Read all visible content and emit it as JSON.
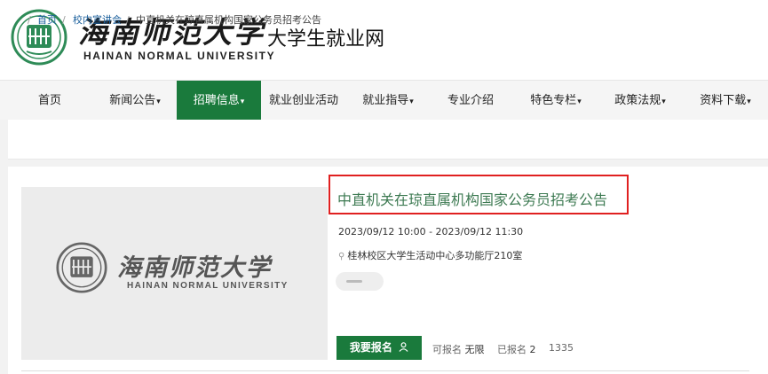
{
  "header": {
    "logo_cn": "海南师范大学",
    "logo_en": "HAINAN NORMAL UNIVERSITY",
    "site_name": "大学生就业网"
  },
  "nav": {
    "items": [
      {
        "label": "首页",
        "has_caret": false
      },
      {
        "label": "新闻公告",
        "has_caret": true
      },
      {
        "label": "招聘信息",
        "has_caret": true,
        "active": true
      },
      {
        "label": "就业创业活动",
        "has_caret": false
      },
      {
        "label": "就业指导",
        "has_caret": true
      },
      {
        "label": "专业介绍",
        "has_caret": false
      },
      {
        "label": "特色专栏",
        "has_caret": true
      },
      {
        "label": "政策法规",
        "has_caret": true
      },
      {
        "label": "资料下载",
        "has_caret": true
      }
    ],
    "caret": "▾",
    "active_color": "#1a7a3c"
  },
  "breadcrumb": {
    "sep": "/",
    "items": [
      "首页",
      "校内宣讲会",
      "中直机关在琼直属机构国家公务员招考公告"
    ]
  },
  "event": {
    "thumb_cn": "海南师范大学",
    "thumb_en": "HAINAN NORMAL UNIVERSITY",
    "title": "中直机关在琼直属机构国家公务员招考公告",
    "time": "2023/09/12 10:00 - 2023/09/12 11:30",
    "place": "桂林校区大学生活动中心多功能厅210室",
    "signup_label": "我要报名",
    "signup_icon": "user-icon",
    "can_signup_label": "可报名",
    "can_signup_value": "无限",
    "signed_label": "已报名",
    "signed_value": "2",
    "views": "1335"
  },
  "colors": {
    "brand_green": "#1a7a3c",
    "title_green": "#3d7a52",
    "highlight_red": "#e02020"
  }
}
